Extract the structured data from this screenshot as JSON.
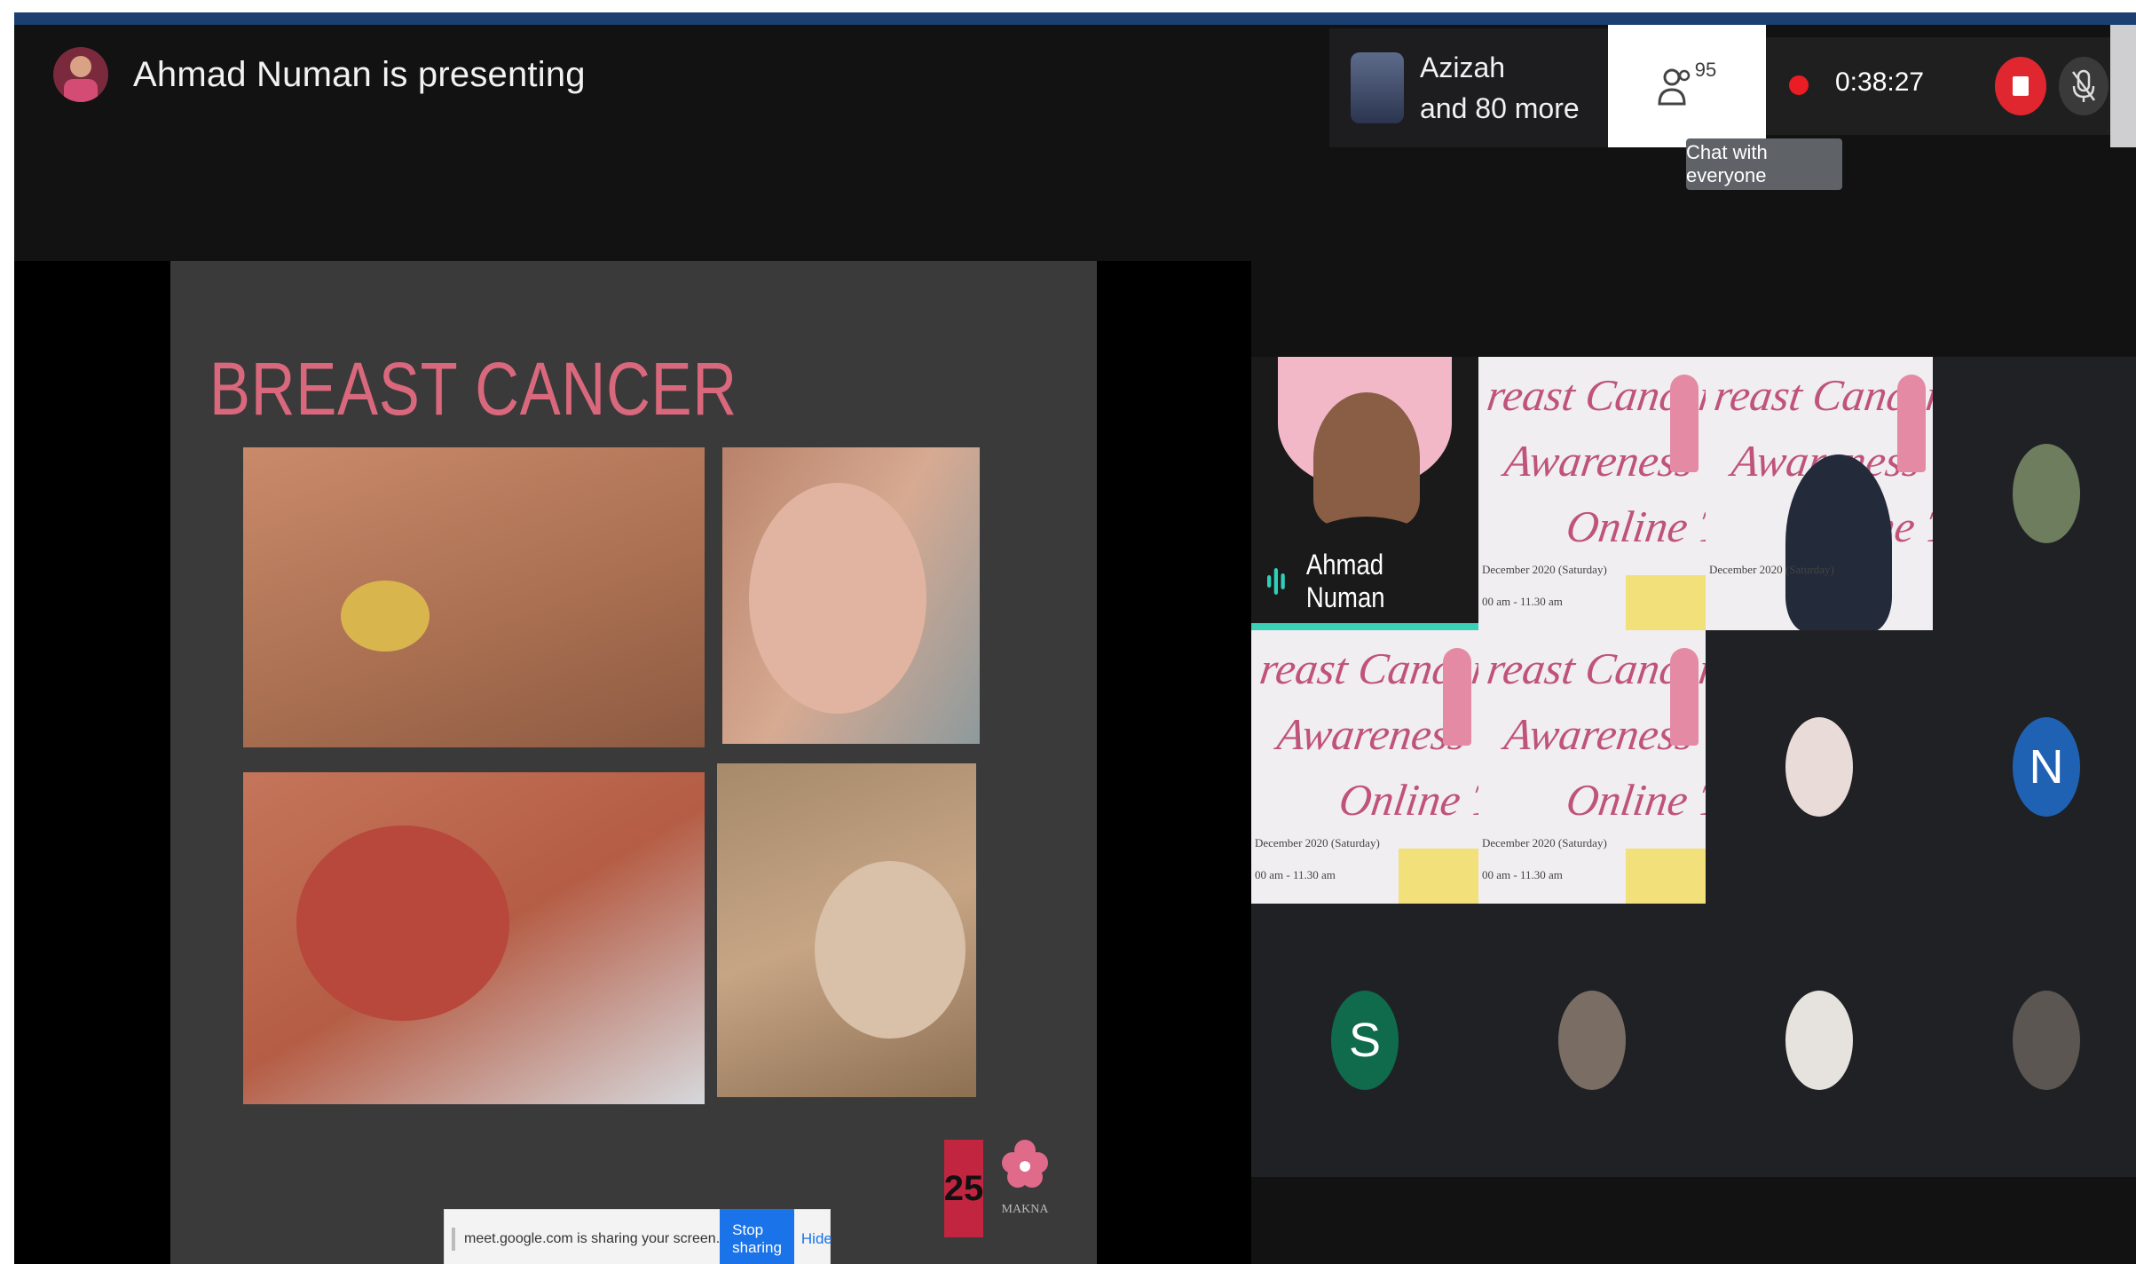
{
  "presenter": {
    "text": "Ahmad Numan is presenting"
  },
  "participants_strip": {
    "name": "Azizah",
    "more": "and 80 more"
  },
  "people_count": "95",
  "recording": {
    "time": "0:38:27"
  },
  "tooltip": "Chat with everyone",
  "slide": {
    "title": "BREAST CANCER",
    "logo_number": "25",
    "logo_name": "MAKNA"
  },
  "share_bar": {
    "message": "meet.google.com is sharing your screen.",
    "stop_label": "Stop sharing",
    "hide_label": "Hide"
  },
  "tiles": {
    "speaker_name": "Ahmad Numan",
    "poster_title_1": "reast Cancer",
    "poster_title_2": "Awareness",
    "poster_title_3": "Online Talk",
    "poster_date": "December 2020 (Saturday)",
    "poster_time": "00 am - 11.30 am",
    "initial_n": "N",
    "initial_s": "S"
  },
  "colors": {
    "accent": "#1a73e8",
    "record": "#ea1c24",
    "speaking": "#3ad1b7",
    "title": "#d9687c"
  }
}
